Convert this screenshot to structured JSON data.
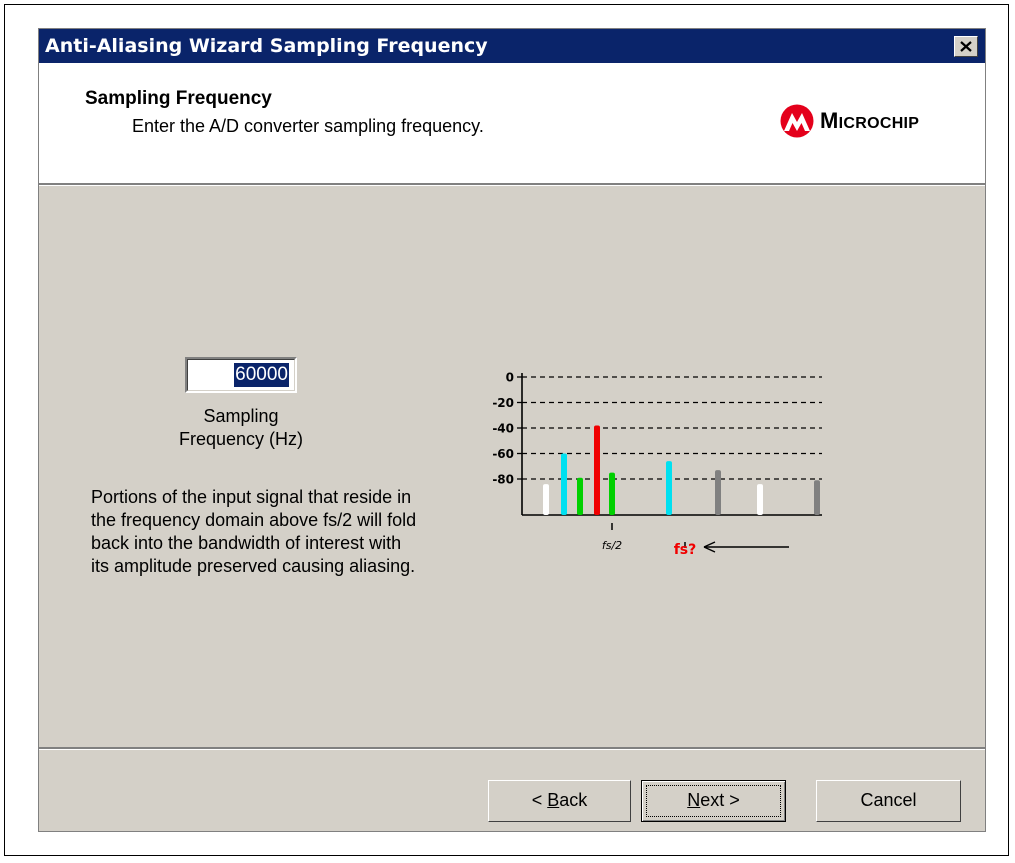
{
  "window": {
    "title": "Anti-Aliasing Wizard Sampling Frequency"
  },
  "header": {
    "title": "Sampling Frequency",
    "subtitle": "Enter the A/D converter sampling frequency.",
    "logo_text_first": "M",
    "logo_text_rest": "ICROCHIP"
  },
  "form": {
    "sampling_frequency_value": "60000",
    "sampling_frequency_label_line1": "Sampling",
    "sampling_frequency_label_line2": "Frequency (Hz)"
  },
  "description": "Portions of the input signal that reside in the frequency domain above fs/2 will fold back into the bandwidth of interest with its amplitude preserved causing aliasing.",
  "buttons": {
    "back_prefix": "< ",
    "back_key": "B",
    "back_rest": "ack",
    "next_key": "N",
    "next_rest": "ext >",
    "cancel": "Cancel"
  },
  "chart_data": {
    "type": "bar",
    "y_ticks": [
      "0",
      "-20",
      "-40",
      "-60",
      "-80"
    ],
    "x_labels": [
      "fs/2",
      "fs?"
    ],
    "grid": "dashed horizontal",
    "colors": {
      "white": "#ffffff",
      "cyan": "#00e0f0",
      "green": "#00d000",
      "red": "#f00000",
      "gray": "#808080",
      "fs_label": "#f00000"
    },
    "bars": [
      {
        "color": "white",
        "value": -84
      },
      {
        "color": "cyan",
        "value": -60
      },
      {
        "color": "green",
        "value": -79
      },
      {
        "color": "red",
        "value": -38
      },
      {
        "color": "green",
        "value": -75
      },
      {
        "color": "cyan",
        "value": -66
      },
      {
        "color": "gray",
        "value": -73
      },
      {
        "color": "white",
        "value": -84
      },
      {
        "color": "gray",
        "value": -81
      }
    ]
  }
}
